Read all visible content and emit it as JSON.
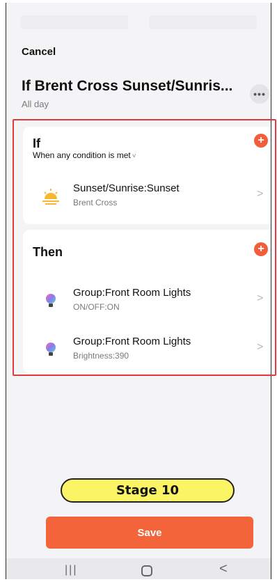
{
  "header": {
    "cancel_label": "Cancel",
    "title": "If Brent Cross Sunset/Sunris...",
    "subtitle": "All day",
    "more_icon": "more-icon"
  },
  "if_section": {
    "title": "If",
    "condition_mode": "When any condition is met",
    "items": [
      {
        "label": "Sunset/Sunrise:Sunset",
        "sub": "Brent Cross",
        "icon": "sunset-icon"
      }
    ]
  },
  "then_section": {
    "title": "Then",
    "items": [
      {
        "label": "Group:Front Room Lights",
        "sub": "ON/OFF:ON",
        "icon": "light-bulb-icon"
      },
      {
        "label": "Group:Front Room Lights",
        "sub": "Brightness:390",
        "icon": "light-bulb-icon"
      }
    ]
  },
  "stage_badge": "Stage 10",
  "save_label": "Save",
  "colors": {
    "accent": "#f3643b",
    "highlight_border": "#e23a3a",
    "badge": "#fbf464"
  }
}
